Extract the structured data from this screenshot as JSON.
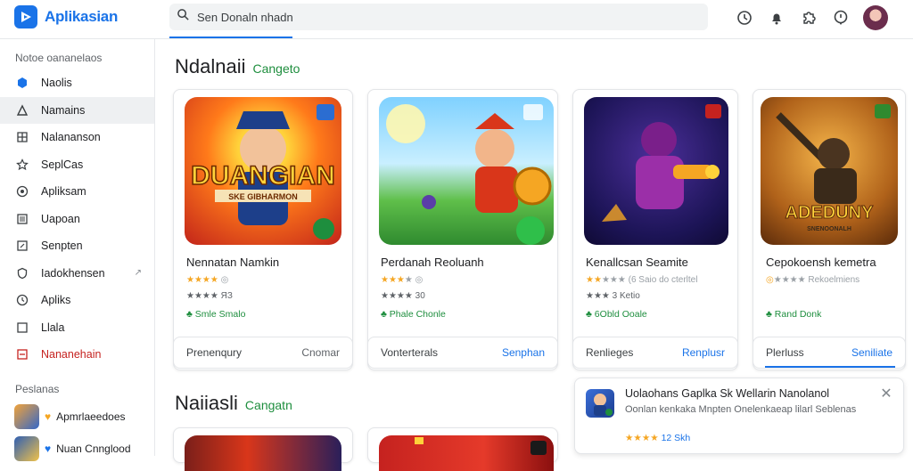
{
  "app": {
    "name": "Aplikasian"
  },
  "search": {
    "value": "Sen Donaln nhadn",
    "icon": "search-icon"
  },
  "top_icons": [
    "clock-icon",
    "bell-icon",
    "puzzle-icon",
    "help-icon"
  ],
  "sidebar": {
    "section_label": "Notoe oananelaos",
    "items": [
      {
        "label": "Naolis",
        "icon": "cube-icon"
      },
      {
        "label": "Namains",
        "icon": "triangle-icon"
      },
      {
        "label": "Nalananson",
        "icon": "grid-icon"
      },
      {
        "label": "SeplCas",
        "icon": "star-icon"
      },
      {
        "label": "Apliksam",
        "icon": "target-icon"
      },
      {
        "label": "Uapoan",
        "icon": "list-icon"
      },
      {
        "label": "Senpten",
        "icon": "edit-icon"
      },
      {
        "label": "Iadokhensen",
        "icon": "shield-icon",
        "ext": "↗"
      },
      {
        "label": "Apliks",
        "icon": "clock-icon"
      },
      {
        "label": "Llala",
        "icon": "square-icon"
      },
      {
        "label": "Nananehain",
        "icon": "box-icon"
      }
    ],
    "apps_label": "Peslanas",
    "apps": [
      {
        "label": "Apmrlaeedoes",
        "prefix": "♥"
      },
      {
        "label": "Nuan Cnnglood",
        "prefix": "♥"
      }
    ]
  },
  "section1": {
    "title": "Ndalnaii",
    "subtitle": "Cangeto"
  },
  "section2": {
    "title": "Naiiasli",
    "subtitle": "Cangatn"
  },
  "cards": [
    {
      "art_text": "DUANGIAN",
      "art_sub": "SKE GIBHARMON",
      "title": "Nennatan Namkin",
      "stars": "★★★★",
      "stars_grey": "",
      "stars_suffix": " ◎",
      "rating": "★★★★ ЯЗ",
      "tag": "♣ Smle Smalo",
      "foot_left": "Prenenqury",
      "foot_right": "Cnomar",
      "accent": "#ff6b1a"
    },
    {
      "art_text": "",
      "art_sub": "",
      "title": "Perdanah Reoluanh",
      "stars": "★★★",
      "stars_grey": "★",
      "stars_suffix": " ◎",
      "rating": "★★★★ 30",
      "tag": "♣ Phale Chonle",
      "foot_left": "Vonterterals",
      "foot_right": "Senphan",
      "accent": "#2f9be0"
    },
    {
      "art_text": "",
      "art_sub": "",
      "title": "Kenallcsan Seamite",
      "stars": "★★",
      "stars_grey": "★★★",
      "stars_suffix": " (6 Saio do cterltel",
      "rating": "★★★ 3 Ketio",
      "tag": "♣ 6Obld Ooale",
      "foot_left": "Renlieges",
      "foot_right": "Renplusr",
      "accent": "#8a2be2"
    },
    {
      "art_text": "ADEDUNY",
      "art_sub": "SNENOONALH",
      "title": "Cepokoensh kemetra",
      "stars": "◎",
      "stars_grey": "★★★★",
      "stars_suffix": " Rekoelmiens",
      "rating": "",
      "tag": "♣ Rand Donk",
      "foot_left": "Plerluss",
      "foot_right": "Seniliate",
      "accent": "#d98a1a"
    }
  ],
  "notification": {
    "title": "Uolaohans Gaplka Sk Wellarin Nanolanol",
    "body": "Oonlan kenkaka Mnpten Onelenkaeap lilarl Seblenas",
    "rating_stars": "★★★★",
    "rating_value": "12 Skh"
  }
}
